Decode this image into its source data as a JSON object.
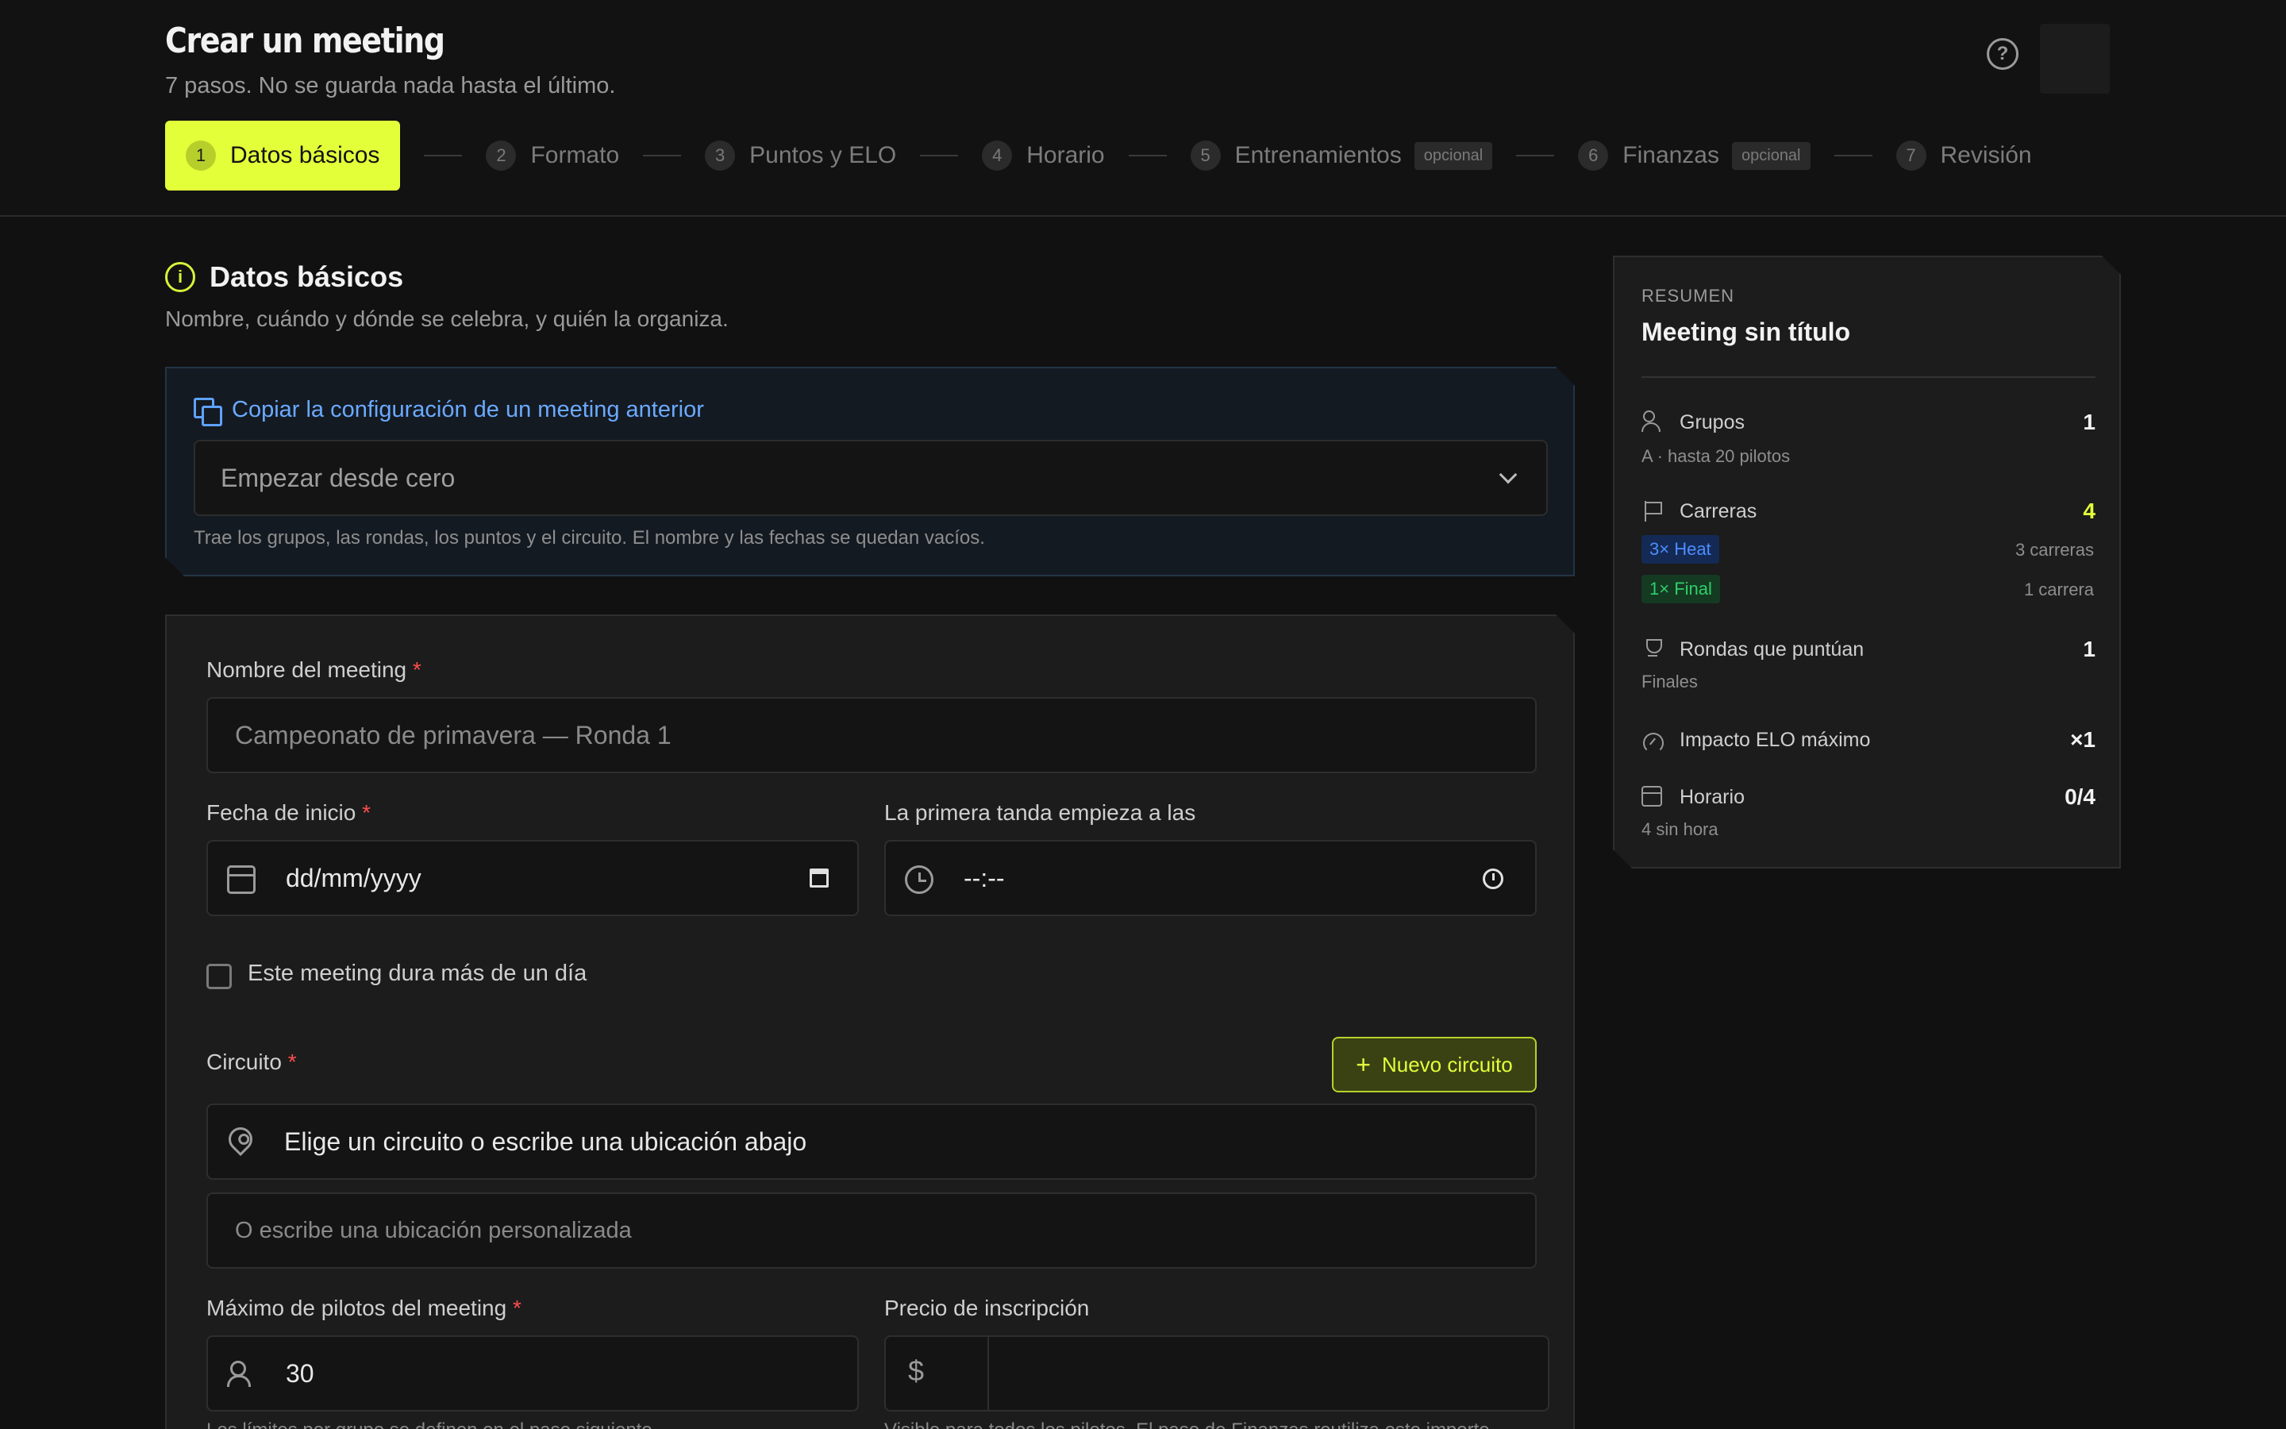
{
  "header": {
    "title": "Crear un meeting",
    "subtitle": "7 pasos. No se guarda nada hasta el último."
  },
  "steps": [
    {
      "num": "1",
      "label": "Datos básicos",
      "optional": ""
    },
    {
      "num": "2",
      "label": "Formato",
      "optional": ""
    },
    {
      "num": "3",
      "label": "Puntos y ELO",
      "optional": ""
    },
    {
      "num": "4",
      "label": "Horario",
      "optional": ""
    },
    {
      "num": "5",
      "label": "Entrenamientos",
      "optional": "opcional"
    },
    {
      "num": "6",
      "label": "Finanzas",
      "optional": "opcional"
    },
    {
      "num": "7",
      "label": "Revisión",
      "optional": ""
    }
  ],
  "section": {
    "title": "Datos básicos",
    "description": "Nombre, cuándo y dónde se celebra, y quién la organiza."
  },
  "copy": {
    "link": "Copiar la configuración de un meeting anterior",
    "select_value": "Empezar desde cero",
    "hint": "Trae los grupos, las rondas, los puntos y el circuito. El nombre y las fechas se quedan vacíos."
  },
  "form": {
    "name_label": "Nombre del meeting",
    "name_placeholder": "Campeonato de primavera — Ronda 1",
    "date_label": "Fecha de inicio",
    "date_placeholder": "dd/mm/yyyy",
    "time_label": "La primera tanda empieza a las",
    "time_placeholder": "--:--",
    "multiday_label": "Este meeting dura más de un día",
    "circuit_label": "Circuito",
    "new_circuit_button": "Nuevo circuito",
    "circuit_value": "Elige un circuito o escribe una ubicación abajo",
    "custom_location_placeholder": "O escribe una ubicación personalizada",
    "max_drivers_label": "Máximo de pilotos del meeting",
    "max_drivers_value": "30",
    "max_drivers_help": "Los límites por grupo se definen en el paso siguiente.",
    "price_label": "Precio de inscripción",
    "price_currency": "$",
    "price_help": "Visible para todos los pilotos. El paso de Finanzas reutiliza este importe.",
    "required_mark": "*"
  },
  "summary": {
    "kicker": "RESUMEN",
    "title": "Meeting sin título",
    "groups_label": "Grupos",
    "groups_value": "1",
    "groups_sub": "A · hasta 20 pilotos",
    "races_label": "Carreras",
    "races_value": "4",
    "heat_tag": "3× Heat",
    "heat_count": "3 carreras",
    "final_tag": "1× Final",
    "final_count": "1 carrera",
    "rounds_label": "Rondas que puntúan",
    "rounds_value": "1",
    "rounds_sub": "Finales",
    "elo_label": "Impacto ELO máximo",
    "elo_value": "×1",
    "schedule_label": "Horario",
    "schedule_value": "0/4",
    "schedule_sub": "4 sin hora"
  },
  "colors": {
    "accent": "#e3ff3a",
    "link": "#6aaaff",
    "required": "#ff4d4d"
  },
  "icons": {
    "help": "?",
    "info": "i",
    "plus": "+"
  }
}
